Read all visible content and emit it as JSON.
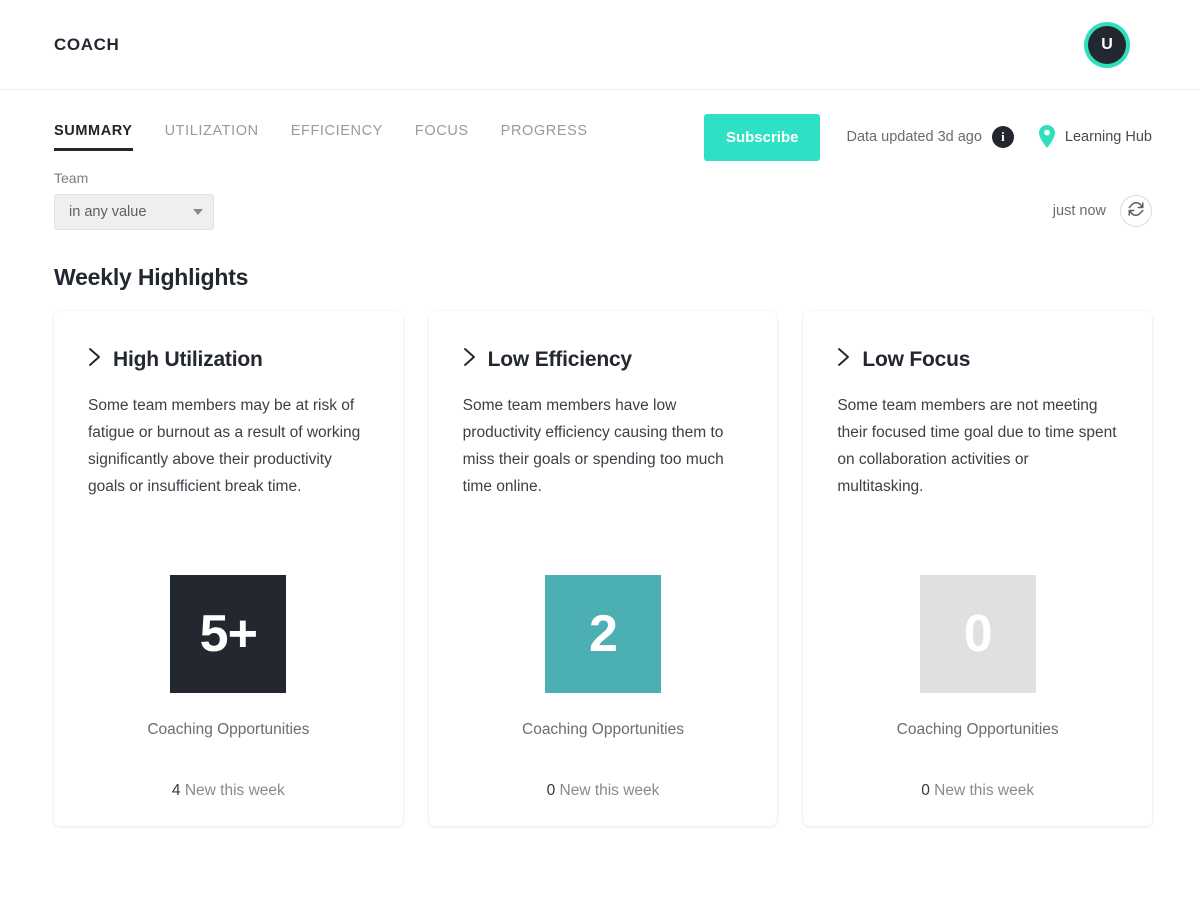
{
  "header": {
    "brand": "COACH",
    "avatar_initial": "U",
    "avatar_ring_color": "#2ee0bd",
    "avatar_bg_color": "#23272f"
  },
  "nav": {
    "tabs": [
      {
        "label": "SUMMARY",
        "active": true
      },
      {
        "label": "UTILIZATION",
        "active": false
      },
      {
        "label": "EFFICIENCY",
        "active": false
      },
      {
        "label": "FOCUS",
        "active": false
      },
      {
        "label": "PROGRESS",
        "active": false
      }
    ],
    "subscribe_label": "Subscribe",
    "subscribe_color": "#2ee0c4",
    "data_updated": "Data updated 3d ago",
    "info_icon": "info-icon",
    "info_glyph": "i",
    "pin_icon": "location-pin-icon",
    "pin_color": "#2ee0bd",
    "learning_hub": "Learning Hub"
  },
  "filters": {
    "team_label": "Team",
    "team_value": "in any value",
    "team_placeholder": "in any value",
    "caret_icon": "chevron-down-icon",
    "refresh_status": "just now",
    "refresh_icon": "refresh-icon"
  },
  "highlights": {
    "section_title": "Weekly Highlights",
    "caption": "Coaching Opportunities",
    "new_suffix": "New this week",
    "chevron_icon": "chevron-right-icon",
    "cards": [
      {
        "title": "High Utilization",
        "description": "Some team members may be at risk of fatigue or burnout as a result of working significantly above their productivity goals or insufficient break time.",
        "value": "5+",
        "tile_color": "#23272f",
        "caption": "Coaching Opportunities",
        "new_count": "4",
        "new_text": "New this week"
      },
      {
        "title": "Low Efficiency",
        "description": "Some team members have low productivity efficiency causing them to miss their goals or spending too much time online.",
        "value": "2",
        "tile_color": "#4bafb4",
        "caption": "Coaching Opportunities",
        "new_count": "0",
        "new_text": "New this week"
      },
      {
        "title": "Low Focus",
        "description": "Some team members are not meeting their focused time goal due to time spent on collaboration activities or multitasking.",
        "value": "0",
        "tile_color": "#e0e0e0",
        "caption": "Coaching Opportunities",
        "new_count": "0",
        "new_text": "New this week"
      }
    ]
  }
}
